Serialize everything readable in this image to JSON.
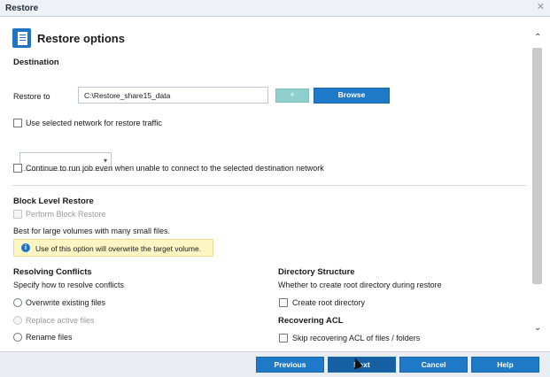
{
  "window": {
    "title": "Restore"
  },
  "header": {
    "title": "Restore options"
  },
  "destination": {
    "section_title": "Destination",
    "restore_to_label": "Restore to",
    "path_value": "C:\\Restore_share15_data",
    "browse_label": "Browse",
    "add_icon": "plus-icon",
    "use_network_label": "Use selected network for restore traffic",
    "network_select_value": "",
    "continue_label": "Continue to run job even when unable to connect to the selected destination network"
  },
  "block_level": {
    "section_title": "Block Level Restore",
    "perform_label": "Perform Block Restore",
    "description": "Best for large volumes with many small files.",
    "warning": "Use of this option will overwrite the target volume."
  },
  "resolving_conflicts": {
    "section_title": "Resolving Conflicts",
    "description": "Specify how to resolve conflicts",
    "options": [
      "Overwrite existing files",
      "Replace active files",
      "Rename files"
    ]
  },
  "directory_structure": {
    "section_title": "Directory Structure",
    "description": "Whether to create root directory during restore",
    "create_root_label": "Create root directory"
  },
  "recovering_acl": {
    "section_title": "Recovering ACL",
    "skip_label": "Skip recovering ACL of files / folders"
  },
  "footer": {
    "previous_label": "Previous",
    "next_label": "Next",
    "cancel_label": "Cancel",
    "help_label": "Help"
  },
  "colors": {
    "primary_button": "#1e7ac8",
    "warning_bg": "#fdf5c4",
    "accent_icon": "#1f74c5"
  }
}
